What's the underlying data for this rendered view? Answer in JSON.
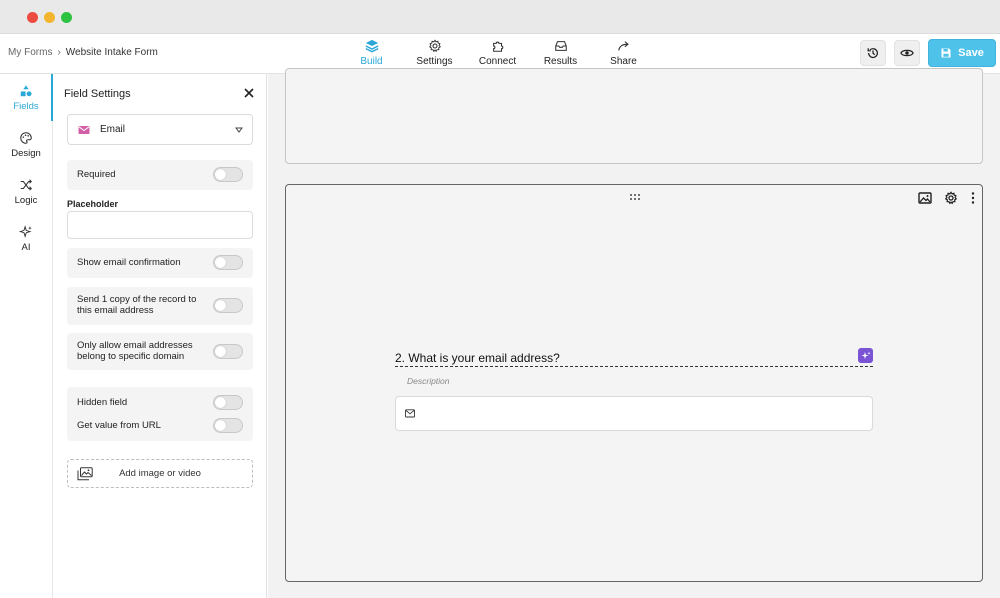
{
  "breadcrumb": {
    "parent": "My Forms",
    "separator": "›",
    "current": "Website Intake Form"
  },
  "nav": {
    "tabs": [
      {
        "label": "Build",
        "icon": "layers-icon",
        "active": true
      },
      {
        "label": "Settings",
        "icon": "gear-icon",
        "active": false
      },
      {
        "label": "Connect",
        "icon": "puzzle-icon",
        "active": false
      },
      {
        "label": "Results",
        "icon": "inbox-icon",
        "active": false
      },
      {
        "label": "Share",
        "icon": "share-arrow-icon",
        "active": false
      }
    ]
  },
  "actions": {
    "history_icon": "history-icon",
    "preview_icon": "eye-icon",
    "save_label": "Save"
  },
  "rail": {
    "items": [
      {
        "label": "Fields",
        "icon": "shapes-icon",
        "active": true
      },
      {
        "label": "Design",
        "icon": "palette-icon",
        "active": false
      },
      {
        "label": "Logic",
        "icon": "shuffle-icon",
        "active": false
      },
      {
        "label": "AI",
        "icon": "sparkle-icon",
        "active": false
      }
    ]
  },
  "field_settings": {
    "title": "Field Settings",
    "field_type": "Email",
    "required_label": "Required",
    "placeholder_label": "Placeholder",
    "placeholder_value": "",
    "show_confirmation_label": "Show email confirmation",
    "send_copy_label": "Send 1 copy of the record to this email address",
    "domain_label": "Only allow email addresses belong to specific domain",
    "hidden_label": "Hidden field",
    "url_value_label": "Get value from URL",
    "add_media_label": "Add image or video"
  },
  "question": {
    "title": "2. What is your email address?",
    "description": "Description"
  },
  "colors": {
    "accent": "#2aa7d6",
    "save": "#4fc2ea",
    "ai": "#7b54d6",
    "email_icon": "#d35fa6"
  }
}
